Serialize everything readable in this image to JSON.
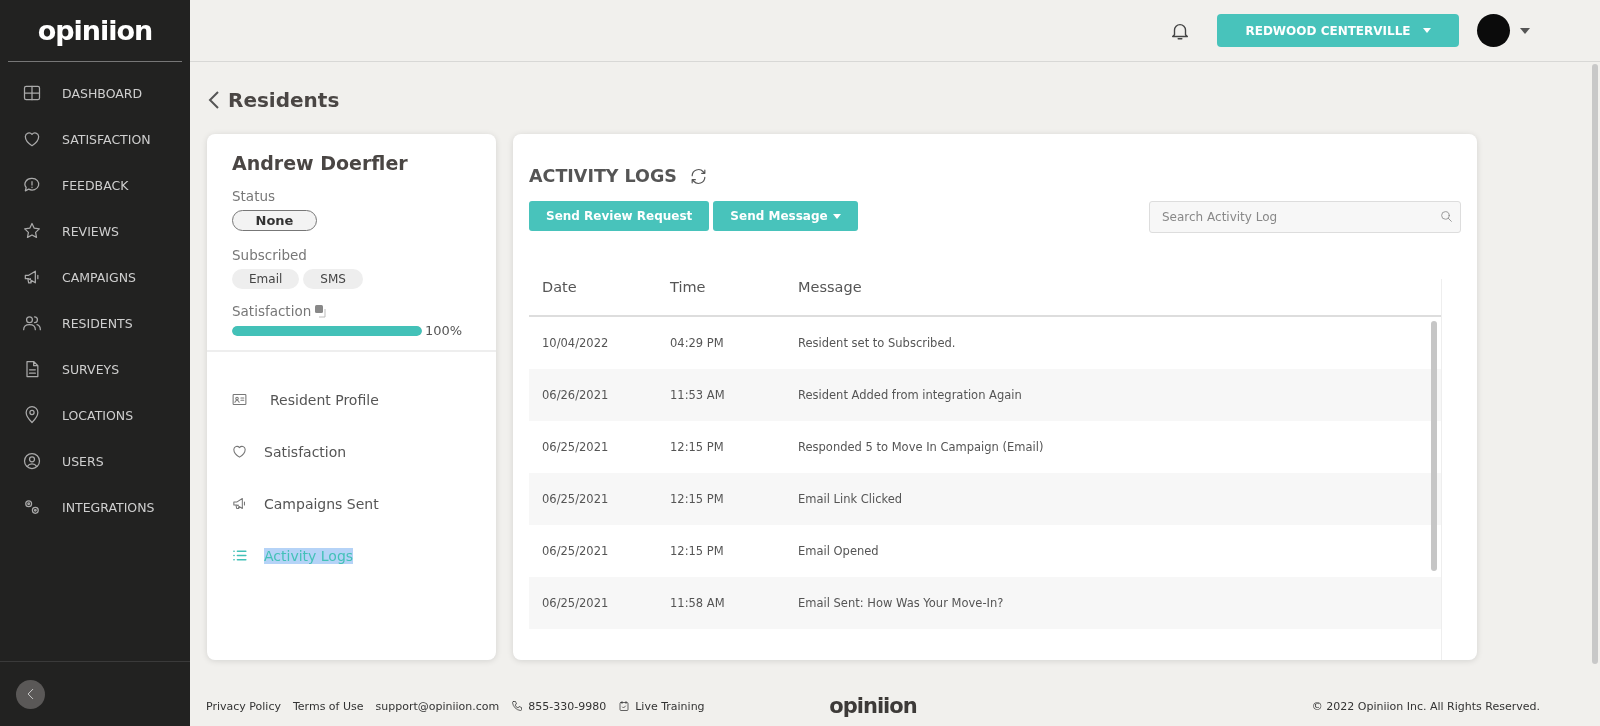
{
  "sidebar": {
    "logo": "opiniion",
    "items": [
      {
        "label": "DASHBOARD"
      },
      {
        "label": "SATISFACTION"
      },
      {
        "label": "FEEDBACK"
      },
      {
        "label": "REVIEWS"
      },
      {
        "label": "CAMPAIGNS"
      },
      {
        "label": "RESIDENTS"
      },
      {
        "label": "SURVEYS"
      },
      {
        "label": "LOCATIONS"
      },
      {
        "label": "USERS"
      },
      {
        "label": "INTEGRATIONS"
      }
    ]
  },
  "header": {
    "location": "REDWOOD CENTERVILLE"
  },
  "breadcrumb": "Residents",
  "resident": {
    "name": "Andrew Doerfler",
    "status_label": "Status",
    "status": "None",
    "subscribed_label": "Subscribed",
    "channels": [
      "Email",
      "SMS"
    ],
    "satisfaction_label": "Satisfaction",
    "satisfaction": {
      "level": 1.0,
      "reading": "100%"
    },
    "nav": [
      {
        "label": "Resident Profile",
        "selected": false
      },
      {
        "label": "Satisfaction",
        "selected": false
      },
      {
        "label": "Campaigns Sent",
        "selected": false
      },
      {
        "label": "Activity Logs",
        "selected": true
      }
    ]
  },
  "activity": {
    "title": "ACTIVITY LOGS",
    "buttons": [
      "Send Review Request",
      "Send Message"
    ],
    "search": {
      "placeholder": "Search Activity Log"
    },
    "columns": [
      "Date",
      "Time",
      "Message"
    ],
    "rows": [
      [
        "10/04/2022",
        "04:29 PM",
        "Resident set to Subscribed."
      ],
      [
        "06/26/2021",
        "11:53 AM",
        "Resident Added from integration Again"
      ],
      [
        "06/25/2021",
        "12:15 PM",
        "Responded 5 to Move In Campaign (Email)"
      ],
      [
        "06/25/2021",
        "12:15 PM",
        "Email Link Clicked"
      ],
      [
        "06/25/2021",
        "12:15 PM",
        "Email Opened"
      ],
      [
        "06/25/2021",
        "11:58 AM",
        "Email Sent: How Was Your Move-In?"
      ]
    ]
  },
  "footer": {
    "links": [
      "Privacy Policy",
      "Terms of Use",
      "support@opiniion.com"
    ],
    "phone": "855-330-9980",
    "training": "Live Training",
    "logo": "opiniion",
    "copyright": "© 2022 Opiniion Inc. All Rights Reserved."
  }
}
